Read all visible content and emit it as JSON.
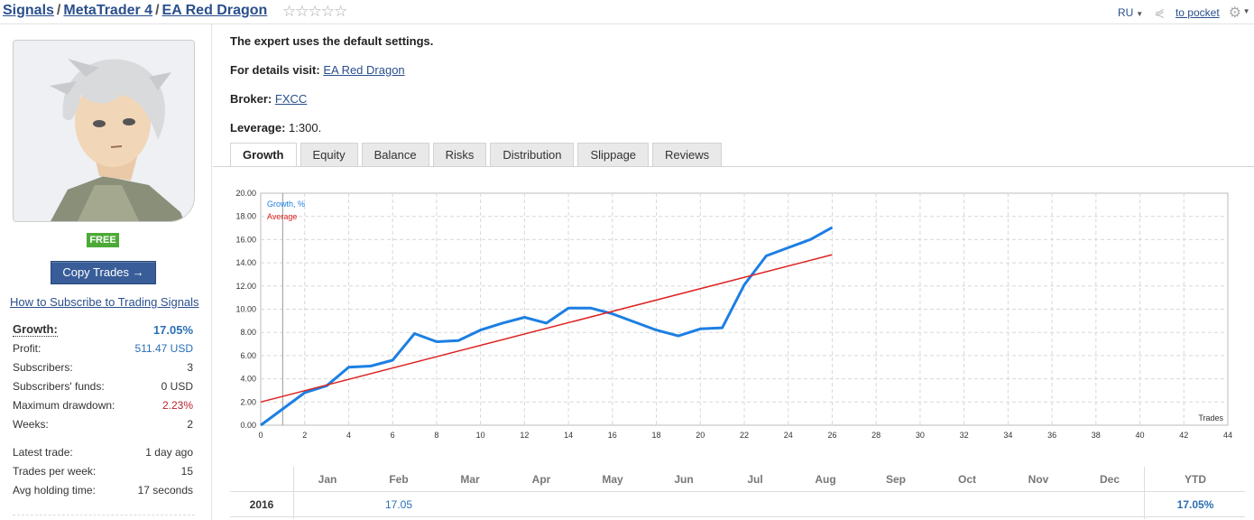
{
  "header": {
    "breadcrumbs": [
      "Signals",
      "MetaTrader 4",
      "EA Red Dragon"
    ],
    "separator": "/",
    "stars": "☆☆☆☆☆",
    "language": "RU",
    "pocket_label": "to pocket"
  },
  "sidebar": {
    "badge": "FREE",
    "copy_button": "Copy Trades →",
    "howto_link": "How to Subscribe to Trading Signals",
    "stats": [
      {
        "label": "Growth:",
        "value": "17.05%"
      },
      {
        "label": "Profit:",
        "value": "511.47 USD"
      },
      {
        "label": "Subscribers:",
        "value": "3"
      },
      {
        "label": "Subscribers' funds:",
        "value": "0 USD"
      },
      {
        "label": "Maximum drawdown:",
        "value": "2.23%"
      },
      {
        "label": "Weeks:",
        "value": "2"
      }
    ],
    "stats2": [
      {
        "label": "Latest trade:",
        "value": "1 day ago"
      },
      {
        "label": "Trades per week:",
        "value": "15"
      },
      {
        "label": "Avg holding time:",
        "value": "17 seconds"
      }
    ]
  },
  "main": {
    "settings_text": "The expert uses the default settings.",
    "details_label": "For details visit:",
    "details_link": "EA Red Dragon",
    "broker_label": "Broker:",
    "broker_link": "FXCC",
    "leverage_label": "Leverage:",
    "leverage_value": "1:300.",
    "tabs": [
      "Growth",
      "Equity",
      "Balance",
      "Risks",
      "Distribution",
      "Slippage",
      "Reviews"
    ],
    "active_tab": 0
  },
  "chart_data": {
    "type": "line",
    "xlabel": "Trades",
    "xlim": [
      0,
      44
    ],
    "ylim": [
      0,
      20
    ],
    "x_ticks": [
      "0",
      "2",
      "4",
      "6",
      "8",
      "10",
      "12",
      "14",
      "16",
      "18",
      "20",
      "22",
      "24",
      "26",
      "28",
      "30",
      "32",
      "34",
      "36",
      "38",
      "40",
      "42",
      "44"
    ],
    "y_ticks": [
      "0.00",
      "2.00",
      "4.00",
      "6.00",
      "8.00",
      "10.00",
      "12.00",
      "14.00",
      "16.00",
      "18.00",
      "20.00"
    ],
    "grid": true,
    "legend_position": "top-left",
    "series": [
      {
        "name": "Growth, %",
        "color": "#1c7fe3",
        "x": [
          0,
          1,
          2,
          3,
          4,
          5,
          6,
          7,
          8,
          9,
          10,
          11,
          12,
          13,
          14,
          15,
          16,
          17,
          18,
          19,
          20,
          21,
          22,
          23,
          24,
          25,
          26
        ],
        "y": [
          0,
          1.4,
          2.8,
          3.4,
          5.0,
          5.1,
          5.6,
          7.9,
          7.2,
          7.3,
          8.2,
          8.8,
          9.3,
          8.8,
          10.1,
          10.1,
          9.6,
          8.9,
          8.2,
          7.7,
          8.3,
          8.4,
          12.1,
          14.6,
          15.3,
          16.0,
          17.05
        ]
      },
      {
        "name": "Average",
        "color": "#dd2222",
        "x": [
          0,
          26
        ],
        "y": [
          2.0,
          14.7
        ]
      }
    ]
  },
  "monthly": {
    "months": [
      "Jan",
      "Feb",
      "Mar",
      "Apr",
      "May",
      "Jun",
      "Jul",
      "Aug",
      "Sep",
      "Oct",
      "Nov",
      "Dec"
    ],
    "ytd_label": "YTD",
    "year": "2016",
    "values": [
      "",
      "17.05",
      "",
      "",
      "",
      "",
      "",
      "",
      "",
      "",
      "",
      ""
    ],
    "ytd": "17.05%"
  }
}
